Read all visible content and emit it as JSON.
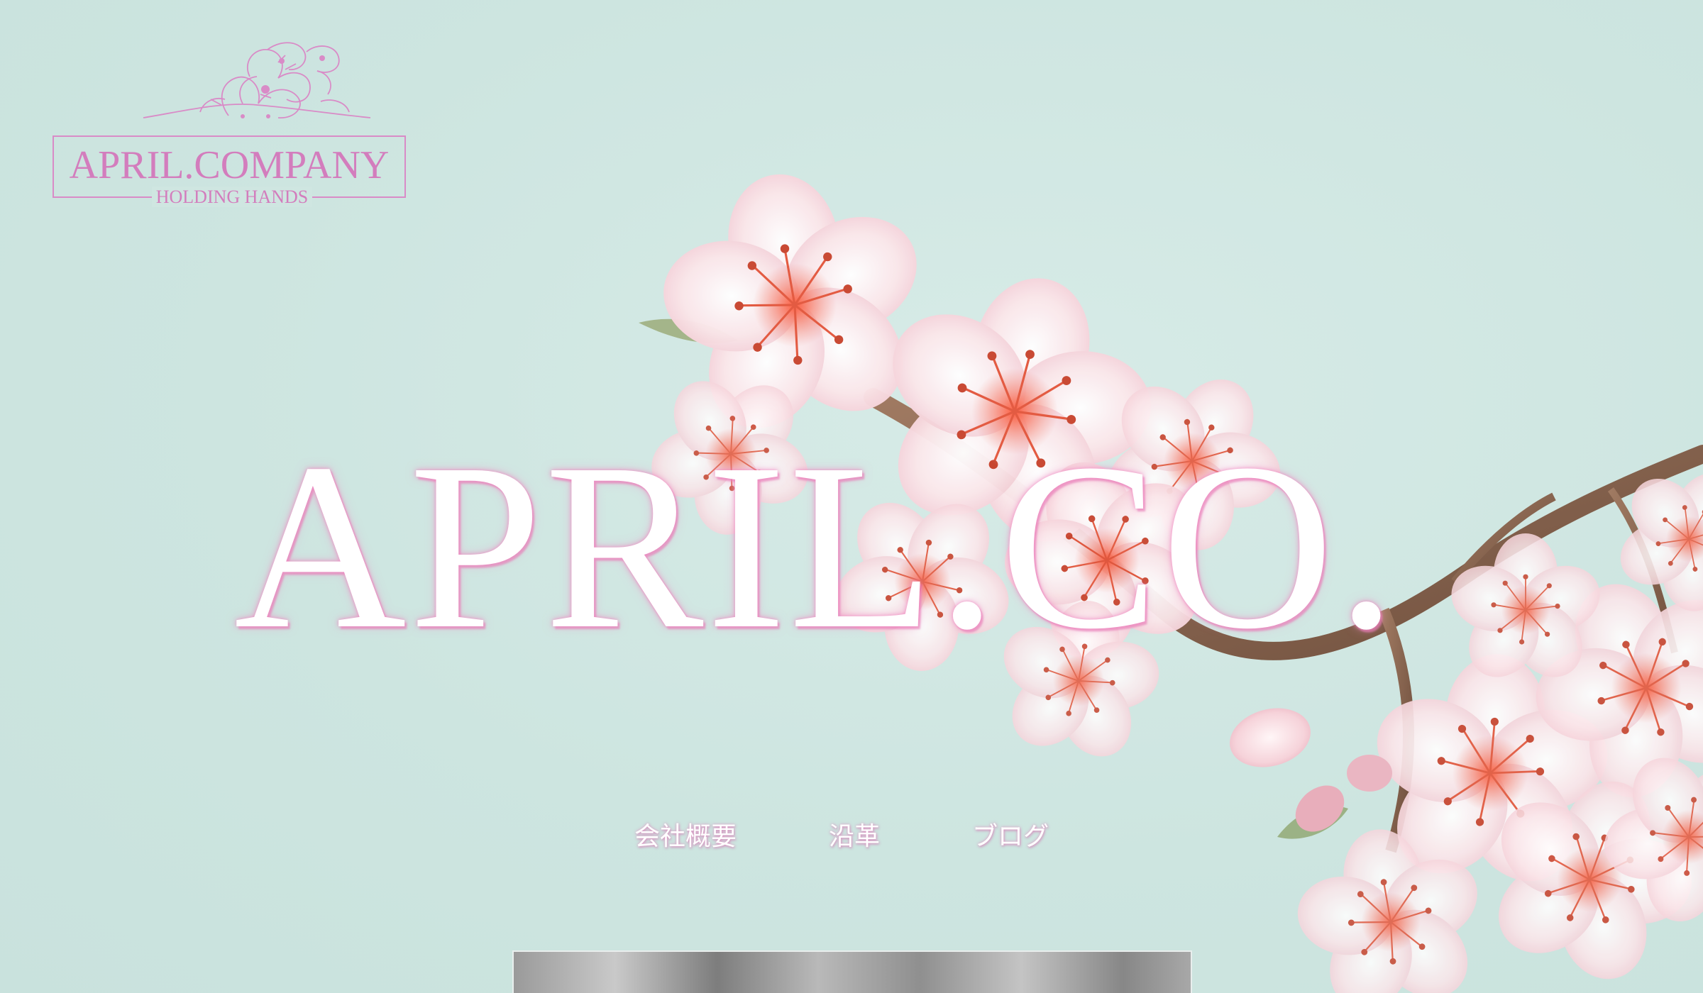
{
  "logo": {
    "name": "APRIL.COMPANY",
    "tagline": "HOLDING HANDS"
  },
  "hero": {
    "title": "APRIL.CO."
  },
  "nav": {
    "items": [
      {
        "label": "会社概要"
      },
      {
        "label": "沿革"
      },
      {
        "label": "ブログ"
      }
    ]
  },
  "colors": {
    "background": "#cfe6e1",
    "logo_pink": "#d37dbd",
    "hero_text": "#ffffff",
    "hero_glow": "#f082be"
  },
  "icons": {
    "logo_ornament": "cherry-blossom-line-art-icon"
  }
}
